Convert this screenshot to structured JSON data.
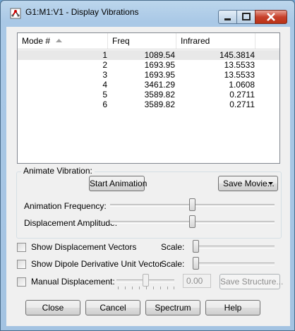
{
  "window": {
    "title": "G1:M1:V1 - Display Vibrations"
  },
  "listview": {
    "columns": [
      "Mode #",
      "Freq",
      "Infrared"
    ],
    "rows": [
      {
        "mode": "1",
        "freq": "1089.54",
        "ir": "145.3814"
      },
      {
        "mode": "2",
        "freq": "1693.95",
        "ir": "13.5533"
      },
      {
        "mode": "3",
        "freq": "1693.95",
        "ir": "13.5533"
      },
      {
        "mode": "4",
        "freq": "3461.29",
        "ir": "1.0608"
      },
      {
        "mode": "5",
        "freq": "3589.82",
        "ir": "0.2711"
      },
      {
        "mode": "6",
        "freq": "3589.82",
        "ir": "0.2711"
      }
    ],
    "selected_row": 0
  },
  "animate": {
    "group_label": "Animate Vibration:",
    "start_button": "Start Animation",
    "save_movie_button": "Save Movie...",
    "frequency_label": "Animation Frequency:",
    "frequency_level": 0.5,
    "amplitude_label": "Displacement Amplitude:",
    "amplitude_level": 0.5
  },
  "options": {
    "show_displacement_vectors": {
      "label": "Show Displacement Vectors",
      "checked": false,
      "scale_label": "Scale:",
      "scale_level": 0.0
    },
    "show_dipole_vector": {
      "label": "Show Dipole Derivative Unit Vector",
      "checked": false,
      "scale_label": "Scale:",
      "scale_level": 0.0
    },
    "manual_displacement": {
      "label": "Manual Displacement:",
      "checked": false,
      "value": "0.00",
      "level": 0.5,
      "save_structure_button": "Save Structure..."
    }
  },
  "footer": {
    "close_button": "Close",
    "cancel_button": "Cancel",
    "spectrum_button": "Spectrum",
    "help_button": "Help"
  },
  "colors": {
    "selected_row": "#e8e8e8",
    "close_button": "#c7412c",
    "dialog_bg": "#f0f0f0",
    "frame": "#a9c8e6"
  }
}
